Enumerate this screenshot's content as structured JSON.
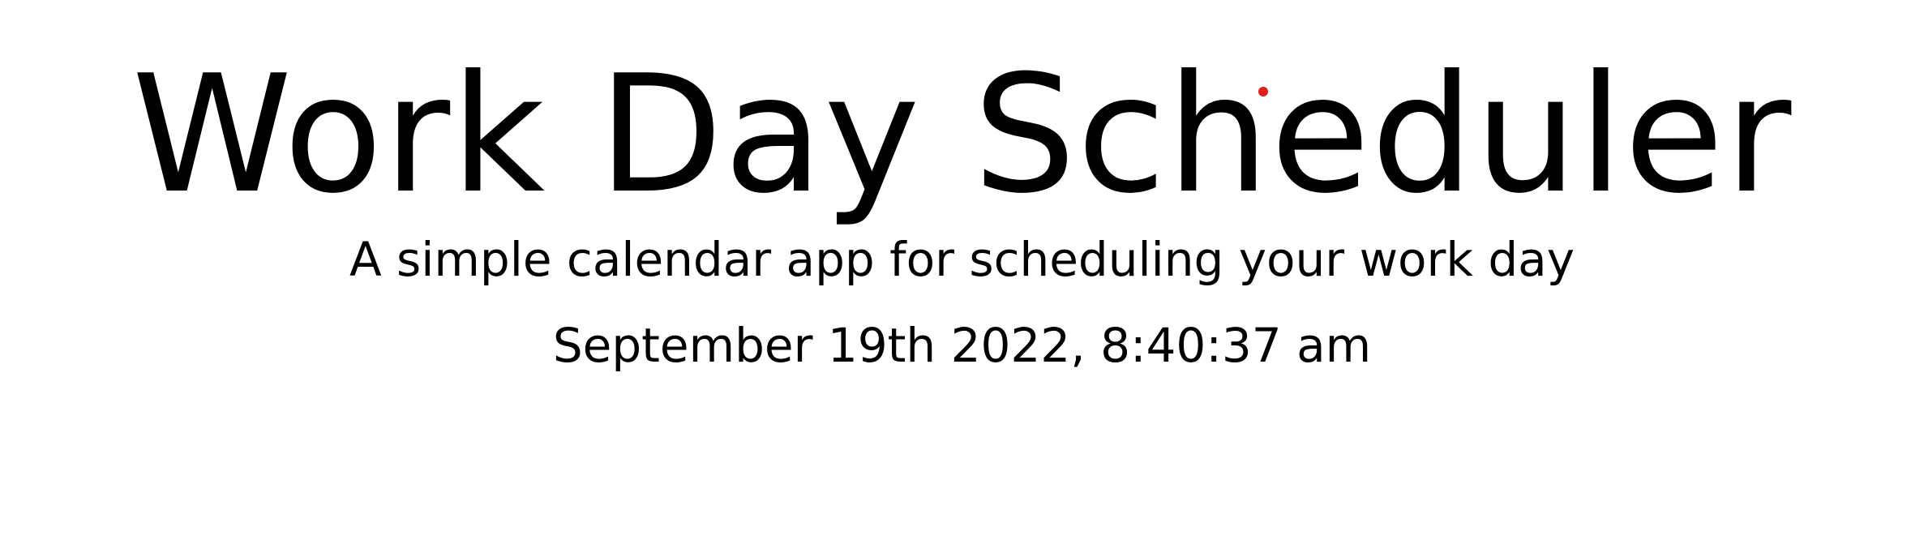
{
  "header": {
    "title": "Work Day Scheduler",
    "subtitle": "A simple calendar app for scheduling your work day",
    "current_datetime": "September 19th 2022, 8:40:37 am"
  },
  "colors": {
    "background": "#ffffff",
    "text": "#000000",
    "cursor_indicator": "#e0201b"
  }
}
